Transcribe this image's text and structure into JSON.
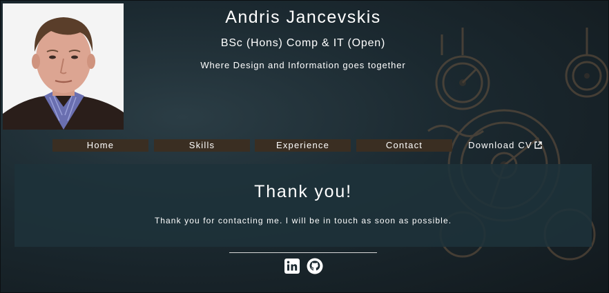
{
  "header": {
    "name": "Andris Jancevskis",
    "degree": "BSc (Hons) Comp & IT (Open)",
    "tagline": "Where Design and Information goes together"
  },
  "nav": {
    "items": [
      {
        "label": "Home"
      },
      {
        "label": "Skills"
      },
      {
        "label": "Experience"
      },
      {
        "label": "Contact"
      },
      {
        "label": "Download CV",
        "icon": "external-link-icon"
      }
    ]
  },
  "message": {
    "title": "Thank you!",
    "text": "Thank you for contacting me. I will be in touch as soon as possible."
  },
  "social": {
    "icons": [
      "linkedin-icon",
      "github-icon"
    ]
  },
  "colors": {
    "nav_background": "#3a2e22",
    "panel_background": "#1e323a",
    "page_background": "#1b2930"
  }
}
